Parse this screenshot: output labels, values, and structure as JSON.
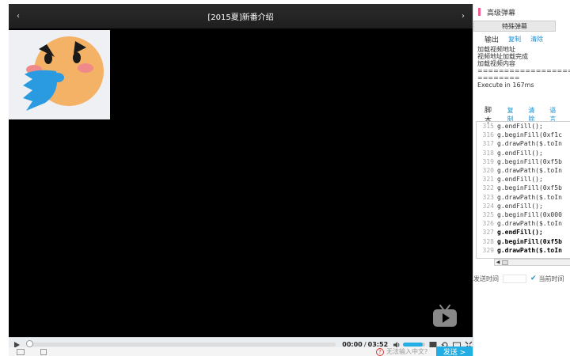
{
  "player": {
    "title": "[2015夏]新番介绍",
    "prev_icon": "chevron-left-icon",
    "next_icon": "chevron-right-icon",
    "time_current": "00:00",
    "time_separator": "/",
    "time_total": "03:52",
    "progress_fraction": 0.0,
    "volume_fraction": 0.88,
    "emoji": "angry-face-breathing-icon",
    "colors": {
      "accent": "#23ade5",
      "title_bg": "#2b2b2b",
      "face": "#f4b266",
      "breath": "#2a9be0"
    }
  },
  "danmaku_input": {
    "hint_icon": "question-mark-icon",
    "hint_text": "无法输入中文?",
    "send_label": "发送 >"
  },
  "panel": {
    "title": "高级弹幕",
    "special_tab": "特殊弹幕",
    "output": {
      "label": "输出",
      "copy": "复制",
      "clear": "清除",
      "lines": [
        "加载视频地址",
        "视频地址加载完成",
        "加载视频内容",
        "======================",
        "========",
        "Execute in 167ms"
      ]
    },
    "script": {
      "label": "脚本",
      "copy": "复制",
      "clear": "清除",
      "lang": "语言",
      "lines": [
        {
          "n": "315",
          "t": "g.endFill();"
        },
        {
          "n": "316",
          "t": "g.beginFill(0xf1c"
        },
        {
          "n": "317",
          "t": "g.drawPath($.toIn"
        },
        {
          "n": "318",
          "t": "g.endFill();"
        },
        {
          "n": "319",
          "t": "g.beginFill(0xf5b"
        },
        {
          "n": "320",
          "t": "g.drawPath($.toIn"
        },
        {
          "n": "321",
          "t": "g.endFill();"
        },
        {
          "n": "322",
          "t": "g.beginFill(0xf5b"
        },
        {
          "n": "323",
          "t": "g.drawPath($.toIn"
        },
        {
          "n": "324",
          "t": "g.endFill();"
        },
        {
          "n": "325",
          "t": "g.beginFill(0x000"
        },
        {
          "n": "326",
          "t": "g.drawPath($.toIn"
        },
        {
          "n": "327",
          "t": "g.endFill();"
        },
        {
          "n": "328",
          "t": "g.beginFill(0xf5b"
        },
        {
          "n": "329",
          "t": "g.drawPath($.toIn"
        }
      ]
    },
    "send_time_label": "发送时间",
    "current_time_label": "当前时间"
  }
}
